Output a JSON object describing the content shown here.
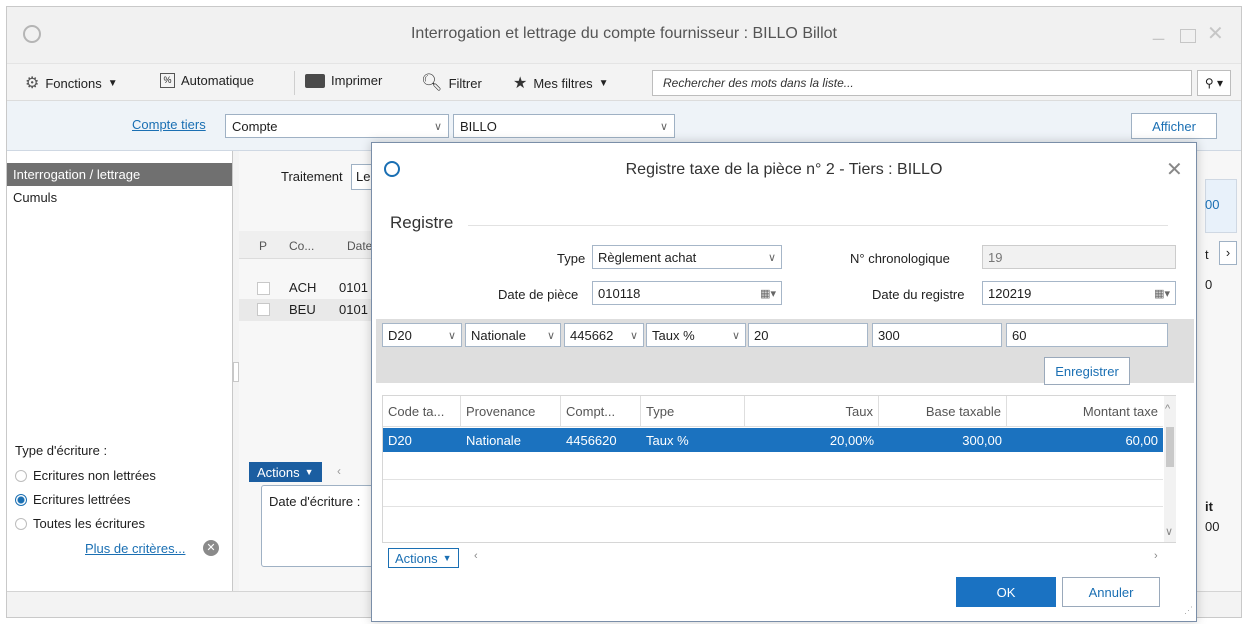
{
  "main_window": {
    "title": "Interrogation et lettrage du compte fournisseur : BILLO Billot"
  },
  "toolbar": {
    "fonctions": "Fonctions",
    "automatique": "Automatique",
    "imprimer": "Imprimer",
    "filtrer": "Filtrer",
    "mes_filtres": "Mes filtres",
    "search_placeholder": "Rechercher des mots dans la liste..."
  },
  "criteria": {
    "compte_tiers_link": "Compte tiers",
    "compte_combo": "Compte",
    "billo_combo": "BILLO",
    "afficher": "Afficher"
  },
  "left_nav": {
    "items": [
      "Interrogation / lettrage",
      "Cumuls"
    ],
    "type_ecriture_label": "Type d'écriture :",
    "radios": [
      "Ecritures non lettrées",
      "Ecritures lettrées",
      "Toutes les écritures"
    ],
    "plus_criteres": "Plus de critères..."
  },
  "right_pane": {
    "traitement_label": "Traitement",
    "traitement_value": "Le",
    "grid_headers": [
      "P",
      "Co...",
      "Date"
    ],
    "rows": [
      {
        "code": "ACH",
        "date": "0101"
      },
      {
        "code": "BEU",
        "date": "0101"
      }
    ],
    "actions": "Actions",
    "date_ecriture": "Date d'écriture :",
    "right_fragment_1": "00",
    "right_fragment_2": "it",
    "right_fragment_3": "00",
    "right_fragment_4": "0",
    "right_fragment_5": "t"
  },
  "dialog": {
    "title": "Registre taxe de la pièce n° 2 - Tiers : BILLO",
    "section": "Registre",
    "type_label": "Type",
    "type_value": "Règlement achat",
    "chrono_label": "N° chronologique",
    "chrono_value": "19",
    "date_piece_label": "Date de pièce",
    "date_piece_value": "010118",
    "date_registre_label": "Date du registre",
    "date_registre_value": "120219",
    "edit_row": {
      "code": "D20",
      "provenance": "Nationale",
      "compte": "445662",
      "type": "Taux %",
      "taux": "20",
      "base": "300",
      "montant": "60"
    },
    "enregistrer": "Enregistrer",
    "table_headers": [
      "Code ta...",
      "Provenance",
      "Compt...",
      "Type",
      "Taux",
      "Base taxable",
      "Montant taxe"
    ],
    "table_rows": [
      {
        "code": "D20",
        "provenance": "Nationale",
        "compte": "4456620",
        "type": "Taux %",
        "taux": "20,00%",
        "base": "300,00",
        "montant": "60,00"
      }
    ],
    "actions": "Actions",
    "ok": "OK",
    "annuler": "Annuler"
  },
  "colors": {
    "accent": "#1a72c2",
    "selected_row": "#1b72bf",
    "nav_selected": "#707070"
  }
}
